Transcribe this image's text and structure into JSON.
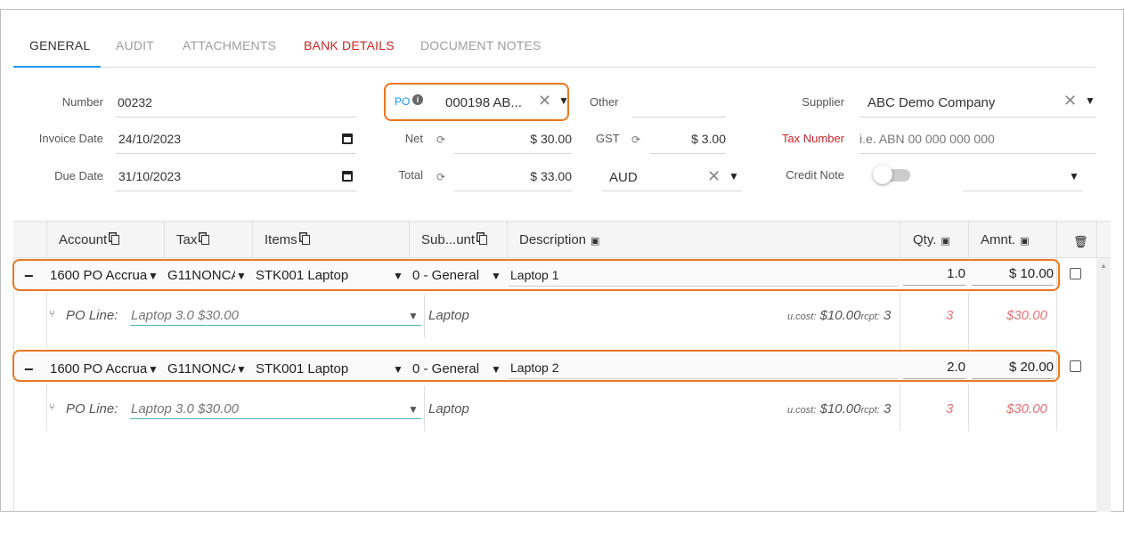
{
  "tabs": [
    {
      "label": "GENERAL",
      "active": true
    },
    {
      "label": "AUDIT"
    },
    {
      "label": "ATTACHMENTS"
    },
    {
      "label": "BANK DETAILS",
      "color": "#c62828"
    },
    {
      "label": "DOCUMENT NOTES"
    }
  ],
  "form": {
    "number_label": "Number",
    "number": "00232",
    "invoice_date_label": "Invoice Date",
    "invoice_date": "24/10/2023",
    "due_date_label": "Due Date",
    "due_date": "31/10/2023",
    "po_label": "PO",
    "po_value": "000198 AB...",
    "net_label": "Net",
    "net": "$ 30.00",
    "total_label": "Total",
    "total": "$ 33.00",
    "other_label": "Other",
    "gst_label": "GST",
    "gst": "$ 3.00",
    "currency": "AUD",
    "supplier_label": "Supplier",
    "supplier": "ABC Demo Company",
    "tax_number_label": "Tax Number",
    "tax_number_placeholder": "i.e. ABN 00 000 000 000",
    "credit_note_label": "Credit Note"
  },
  "grid": {
    "headers": {
      "account": "Account",
      "tax": "Tax",
      "items": "Items",
      "subaccount": "Sub...unt",
      "description": "Description",
      "qty": "Qty.",
      "amount": "Amnt."
    },
    "rows": [
      {
        "account": "1600 PO Accrua",
        "tax": "G11NONCA",
        "item": "STK001 Laptop",
        "sub": "0 - General",
        "description": "Laptop 1",
        "qty": "1.0",
        "amount": "$ 10.00",
        "po_line_label": "PO Line:",
        "po_line": "Laptop 3.0 $30.00",
        "po_desc": "Laptop",
        "ucost_label": "u.cost:",
        "ucost": "$10.00",
        "rcpt_label": "rcpt:",
        "rcpt": "3",
        "po_qty": "3",
        "po_amount": "$30.00"
      },
      {
        "account": "1600 PO Accrua",
        "tax": "G11NONCA",
        "item": "STK001 Laptop",
        "sub": "0 - General",
        "description": "Laptop 2",
        "qty": "2.0",
        "amount": "$ 20.00",
        "po_line_label": "PO Line:",
        "po_line": "Laptop 3.0 $30.00",
        "po_desc": "Laptop",
        "ucost_label": "u.cost:",
        "ucost": "$10.00",
        "rcpt_label": "rcpt:",
        "rcpt": "3",
        "po_qty": "3",
        "po_amount": "$30.00"
      }
    ]
  },
  "colors": {
    "accent": "#2196f3",
    "highlight": "#e87722",
    "alert": "#c62828"
  }
}
